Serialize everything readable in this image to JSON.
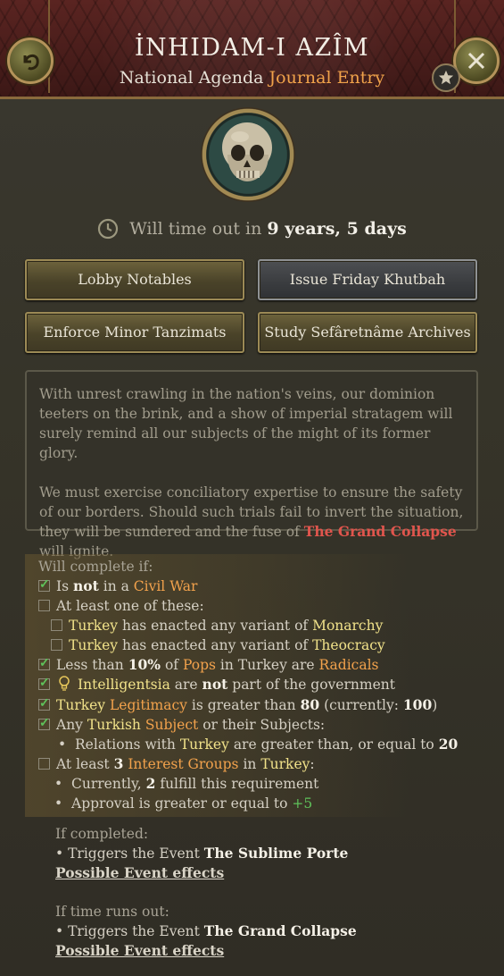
{
  "header": {
    "title": "İNHIDAM-I AZÎM",
    "subtitle_prefix": "National Agenda",
    "subtitle_accent": "Journal Entry"
  },
  "icons": {
    "back": "back-arrow-icon",
    "close": "close-icon",
    "star": "star-icon",
    "medallion": "skull-icon",
    "clock": "clock-icon",
    "bulb": "lightbulb-icon"
  },
  "timeout": {
    "prefix": "Will time out in",
    "value": "9 years, 5 days"
  },
  "actions": [
    "Lobby Notables",
    "Issue Friday Khutbah",
    "Enforce Minor Tanzimats",
    "Study Sefâretnâme Archives"
  ],
  "description": {
    "para1": "With unrest crawling in the nation's veins, our dominion teeters on the brink, and a show of imperial stratagem will surely remind all our subjects of the might of its former glory.",
    "para2_prefix": "We must exercise conciliatory expertise to ensure the safety of our borders. Should such trials fail to invert the situation, they will be sundered and the fuse of",
    "para2_link": "The Grand Collapse",
    "para2_suffix": "will ignite."
  },
  "conditions": {
    "header": "Will complete if:",
    "c1": {
      "a": "Is",
      "b": "not",
      "c": "in a",
      "d": "Civil War"
    },
    "c2": "At least one of these:",
    "c2a": {
      "a": "Turkey",
      "b": "has enacted any variant of",
      "c": "Monarchy"
    },
    "c2b": {
      "a": "Turkey",
      "b": "has enacted any variant of",
      "c": "Theocracy"
    },
    "c3": {
      "a": "Less than",
      "b": "10%",
      "c": "of",
      "d": "Pops",
      "e": "in Turkey are",
      "f": "Radicals"
    },
    "c4": {
      "a": "Intelligentsia",
      "b": "are",
      "c": "not",
      "d": "part of the government"
    },
    "c5": {
      "a": "Turkey",
      "b": "Legitimacy",
      "c": "is greater than",
      "d": "80",
      "e": "(currently:",
      "f": "100",
      "g": ")"
    },
    "c6": {
      "a": "Any",
      "b": "Turkish",
      "c": "Subject",
      "d": "or their Subjects:"
    },
    "c6a": {
      "a": "Relations with",
      "b": "Turkey",
      "c": "are greater than, or equal to",
      "d": "20"
    },
    "c7": {
      "a": "At least",
      "b": "3",
      "c": "Interest Groups",
      "d": "in",
      "e": "Turkey",
      "f": ":"
    },
    "c7a": {
      "a": "Currently,",
      "b": "2",
      "c": "fulfill this requirement"
    },
    "c7b": {
      "a": "Approval is greater or equal to",
      "b": "+5"
    }
  },
  "completed": {
    "label": "If completed:",
    "prefix": "• Triggers the Event",
    "event": "The Sublime Porte",
    "link": "Possible Event effects"
  },
  "timeout_result": {
    "label": "If time runs out:",
    "prefix": "• Triggers the Event",
    "event": "The Grand Collapse",
    "link": "Possible Event effects"
  },
  "colors": {
    "accent_orange": "#f2a24c",
    "accent_yellow": "#f1e28a",
    "accent_red": "#e0554d",
    "check_green": "#5fc25a"
  }
}
